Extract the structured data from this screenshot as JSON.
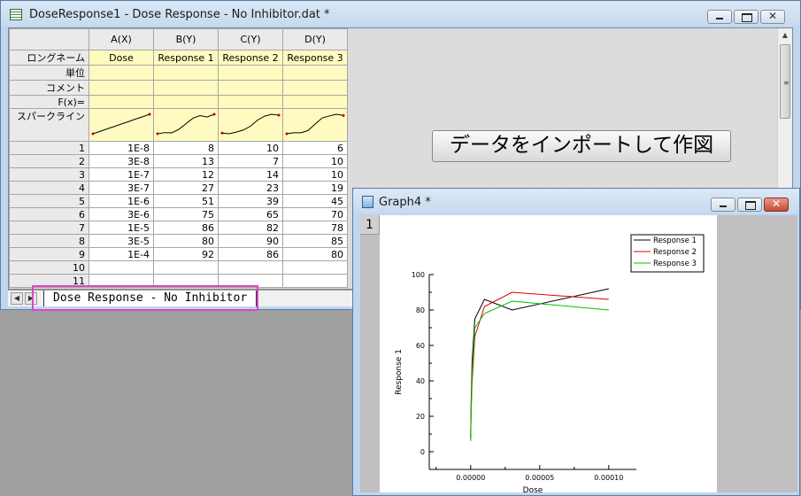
{
  "workbook": {
    "title": "DoseResponse1 - Dose Response - No Inhibitor.dat *",
    "columns": [
      "A(X)",
      "B(Y)",
      "C(Y)",
      "D(Y)"
    ],
    "row_labels": {
      "long_name": "ロングネーム",
      "units": "単位",
      "comments": "コメント",
      "fx": "F(x)=",
      "sparklines": "スパークライン"
    },
    "long_names": [
      "Dose",
      "Response 1",
      "Response 2",
      "Response 3"
    ],
    "rows": [
      {
        "n": "1",
        "cells": [
          "1E-8",
          "8",
          "10",
          "6"
        ]
      },
      {
        "n": "2",
        "cells": [
          "3E-8",
          "13",
          "7",
          "10"
        ]
      },
      {
        "n": "3",
        "cells": [
          "1E-7",
          "12",
          "14",
          "10"
        ]
      },
      {
        "n": "4",
        "cells": [
          "3E-7",
          "27",
          "23",
          "19"
        ]
      },
      {
        "n": "5",
        "cells": [
          "1E-6",
          "51",
          "39",
          "45"
        ]
      },
      {
        "n": "6",
        "cells": [
          "3E-6",
          "75",
          "65",
          "70"
        ]
      },
      {
        "n": "7",
        "cells": [
          "1E-5",
          "86",
          "82",
          "78"
        ]
      },
      {
        "n": "8",
        "cells": [
          "3E-5",
          "80",
          "90",
          "85"
        ]
      },
      {
        "n": "9",
        "cells": [
          "1E-4",
          "92",
          "86",
          "80"
        ]
      },
      {
        "n": "10",
        "cells": [
          "",
          "",
          "",
          ""
        ]
      },
      {
        "n": "11",
        "cells": [
          "",
          "",
          "",
          ""
        ]
      }
    ],
    "import_button": "データをインポートして作図",
    "sheet_tab": "Dose Response - No Inhibitor",
    "highlight_color": "#e043c8"
  },
  "graph": {
    "title": "Graph4 *",
    "layer": "1",
    "chart_data": {
      "type": "line",
      "xlabel": "Dose",
      "ylabel": "Response 1",
      "xlim": [
        -3e-05,
        0.00012
      ],
      "ylim": [
        -10,
        100
      ],
      "x_ticks": [
        0.0,
        5e-05,
        0.0001
      ],
      "x_tick_labels": [
        "0.00000",
        "0.00005",
        "0.00010"
      ],
      "y_ticks": [
        0,
        20,
        40,
        60,
        80,
        100
      ],
      "x": [
        1e-08,
        3e-08,
        1e-07,
        3e-07,
        1e-06,
        3e-06,
        1e-05,
        3e-05,
        0.0001
      ],
      "series": [
        {
          "name": "Response 1",
          "color": "#000000",
          "values": [
            8,
            13,
            12,
            27,
            51,
            75,
            86,
            80,
            92
          ]
        },
        {
          "name": "Response 2",
          "color": "#e00000",
          "values": [
            10,
            7,
            14,
            23,
            39,
            65,
            82,
            90,
            86
          ]
        },
        {
          "name": "Response 3",
          "color": "#00c000",
          "values": [
            6,
            10,
            10,
            19,
            45,
            70,
            78,
            85,
            80
          ]
        }
      ],
      "legend_position": "top-right",
      "grid": false
    }
  },
  "icons": {
    "minimize": "minimize-icon",
    "maximize": "maximize-icon",
    "close": "close-icon",
    "close_glyph": "✕",
    "scroll_up": "▲",
    "scroll_down": "▼",
    "tab_prev": "◀",
    "tab_next": "▶",
    "grip": "≡"
  }
}
